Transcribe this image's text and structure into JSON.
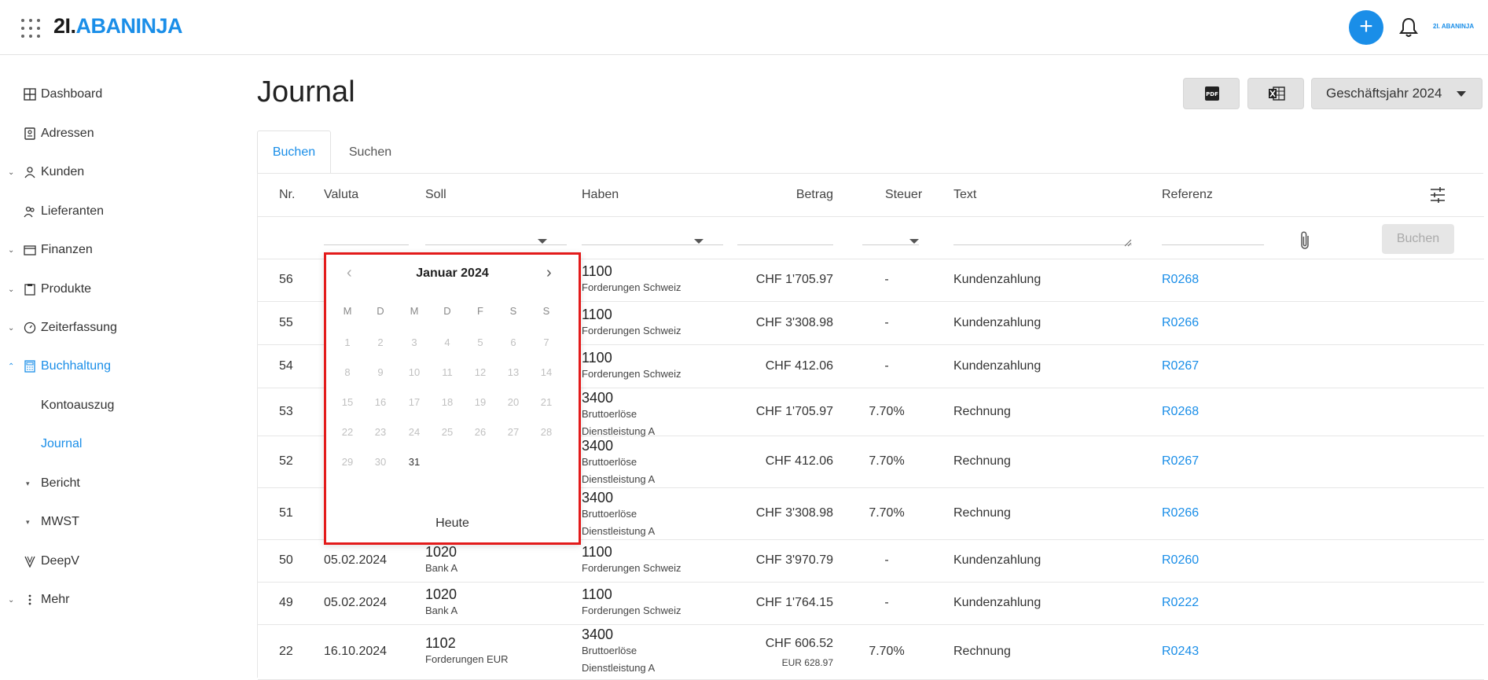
{
  "brand": {
    "num": "2I.",
    "name": "ABANINJA",
    "mini": "2I. ABANINJA"
  },
  "header": {
    "add_label": "+"
  },
  "sidebar": {
    "items": [
      {
        "label": "Dashboard"
      },
      {
        "label": "Adressen"
      },
      {
        "label": "Kunden"
      },
      {
        "label": "Lieferanten"
      },
      {
        "label": "Finanzen"
      },
      {
        "label": "Produkte"
      },
      {
        "label": "Zeiterfassung"
      },
      {
        "label": "Buchhaltung"
      },
      {
        "label": "Kontoauszug"
      },
      {
        "label": "Journal"
      },
      {
        "label": "Bericht"
      },
      {
        "label": "MWST"
      },
      {
        "label": "DeepV"
      },
      {
        "label": "Mehr"
      }
    ]
  },
  "page": {
    "title": "Journal",
    "fiscal_year": "Geschäftsjahr 2024"
  },
  "tabs": [
    {
      "label": "Buchen"
    },
    {
      "label": "Suchen"
    }
  ],
  "table": {
    "columns": [
      "Nr.",
      "Valuta",
      "Soll",
      "Haben",
      "Betrag",
      "Steuer",
      "Text",
      "Referenz"
    ],
    "book_button": "Buchen",
    "rows": [
      {
        "nr": "56",
        "valuta": "",
        "soll_num": "",
        "soll_name": "",
        "haben_num": "1100",
        "haben_name": "Forderungen Schweiz",
        "haben_name2": "",
        "betrag": "CHF 1'705.97",
        "betrag2": "",
        "steuer": "-",
        "text": "Kundenzahlung",
        "ref": "R0268"
      },
      {
        "nr": "55",
        "valuta": "",
        "soll_num": "",
        "soll_name": "",
        "haben_num": "1100",
        "haben_name": "Forderungen Schweiz",
        "haben_name2": "",
        "betrag": "CHF 3'308.98",
        "betrag2": "",
        "steuer": "-",
        "text": "Kundenzahlung",
        "ref": "R0266"
      },
      {
        "nr": "54",
        "valuta": "",
        "soll_num": "",
        "soll_name": "",
        "haben_num": "1100",
        "haben_name": "Forderungen Schweiz",
        "haben_name2": "",
        "betrag": "CHF 412.06",
        "betrag2": "",
        "steuer": "-",
        "text": "Kundenzahlung",
        "ref": "R0267"
      },
      {
        "nr": "53",
        "valuta": "",
        "soll_num": "",
        "soll_name": "",
        "haben_num": "3400",
        "haben_name": "Bruttoerlöse",
        "haben_name2": "Dienstleistung A",
        "betrag": "CHF 1'705.97",
        "betrag2": "",
        "steuer": "7.70%",
        "text": "Rechnung",
        "ref": "R0268"
      },
      {
        "nr": "52",
        "valuta": "",
        "soll_num": "",
        "soll_name": "",
        "haben_num": "3400",
        "haben_name": "Bruttoerlöse",
        "haben_name2": "Dienstleistung A",
        "betrag": "CHF 412.06",
        "betrag2": "",
        "steuer": "7.70%",
        "text": "Rechnung",
        "ref": "R0267"
      },
      {
        "nr": "51",
        "valuta": "",
        "soll_num": "",
        "soll_name": "",
        "haben_num": "3400",
        "haben_name": "Bruttoerlöse",
        "haben_name2": "Dienstleistung A",
        "betrag": "CHF 3'308.98",
        "betrag2": "",
        "steuer": "7.70%",
        "text": "Rechnung",
        "ref": "R0266"
      },
      {
        "nr": "50",
        "valuta": "05.02.2024",
        "soll_num": "1020",
        "soll_name": "Bank A",
        "haben_num": "1100",
        "haben_name": "Forderungen Schweiz",
        "haben_name2": "",
        "betrag": "CHF 3'970.79",
        "betrag2": "",
        "steuer": "-",
        "text": "Kundenzahlung",
        "ref": "R0260"
      },
      {
        "nr": "49",
        "valuta": "05.02.2024",
        "soll_num": "1020",
        "soll_name": "Bank A",
        "haben_num": "1100",
        "haben_name": "Forderungen Schweiz",
        "haben_name2": "",
        "betrag": "CHF 1'764.15",
        "betrag2": "",
        "steuer": "-",
        "text": "Kundenzahlung",
        "ref": "R0222"
      },
      {
        "nr": "22",
        "valuta": "16.10.2024",
        "soll_num": "1102",
        "soll_name": "Forderungen EUR",
        "haben_num": "3400",
        "haben_name": "Bruttoerlöse",
        "haben_name2": "Dienstleistung A",
        "betrag": "CHF 606.52",
        "betrag2": "EUR 628.97",
        "steuer": "7.70%",
        "text": "Rechnung",
        "ref": "R0243"
      }
    ]
  },
  "datepicker": {
    "month": "Januar 2024",
    "weekdays": [
      "M",
      "D",
      "M",
      "D",
      "F",
      "S",
      "S"
    ],
    "days": [
      "1",
      "2",
      "3",
      "4",
      "5",
      "6",
      "7",
      "8",
      "9",
      "10",
      "11",
      "12",
      "13",
      "14",
      "15",
      "16",
      "17",
      "18",
      "19",
      "20",
      "21",
      "22",
      "23",
      "24",
      "25",
      "26",
      "27",
      "28",
      "29",
      "30",
      "31"
    ],
    "enabled_days": [
      "31"
    ],
    "today": "Heute"
  }
}
